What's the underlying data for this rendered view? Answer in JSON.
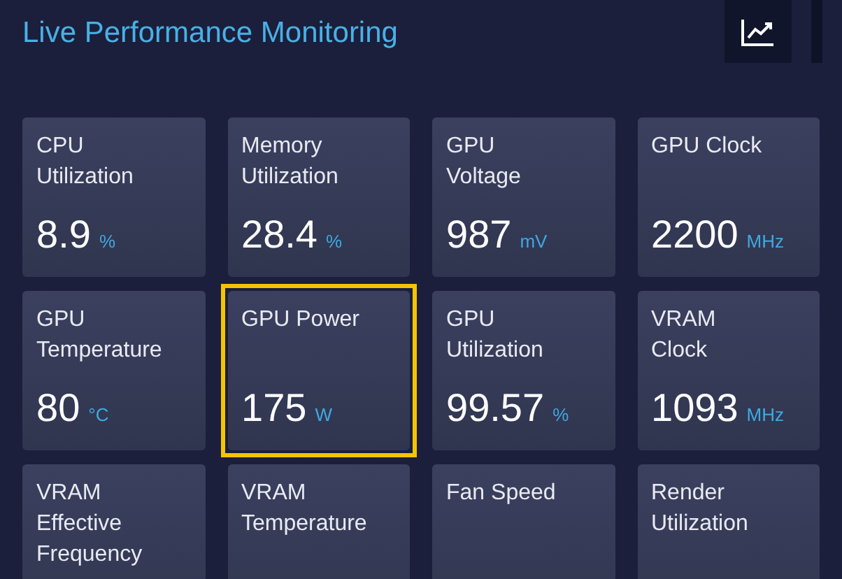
{
  "header": {
    "title": "Live Performance Monitoring"
  },
  "metrics": [
    {
      "label_lines": [
        "CPU",
        "Utilization"
      ],
      "value": "8.9",
      "unit": "%",
      "highlighted": false
    },
    {
      "label_lines": [
        "Memory",
        "Utilization"
      ],
      "value": "28.4",
      "unit": "%",
      "highlighted": false
    },
    {
      "label_lines": [
        "GPU",
        "Voltage"
      ],
      "value": "987",
      "unit": "mV",
      "highlighted": false
    },
    {
      "label_lines": [
        "GPU Clock"
      ],
      "value": "2200",
      "unit": "MHz",
      "highlighted": false
    },
    {
      "label_lines": [
        "GPU",
        "Temperature"
      ],
      "value": "80",
      "unit": "°C",
      "highlighted": false
    },
    {
      "label_lines": [
        "GPU Power"
      ],
      "value": "175",
      "unit": "W",
      "highlighted": true
    },
    {
      "label_lines": [
        "GPU",
        "Utilization"
      ],
      "value": "99.57",
      "unit": "%",
      "highlighted": false
    },
    {
      "label_lines": [
        "VRAM",
        "Clock"
      ],
      "value": "1093",
      "unit": "MHz",
      "highlighted": false
    },
    {
      "label_lines": [
        "VRAM",
        "Effective",
        "Frequency"
      ],
      "highlighted": false
    },
    {
      "label_lines": [
        "VRAM",
        "Temperature"
      ],
      "highlighted": false
    },
    {
      "label_lines": [
        "Fan Speed"
      ],
      "highlighted": false
    },
    {
      "label_lines": [
        "Render",
        "Utilization"
      ],
      "highlighted": false
    }
  ]
}
